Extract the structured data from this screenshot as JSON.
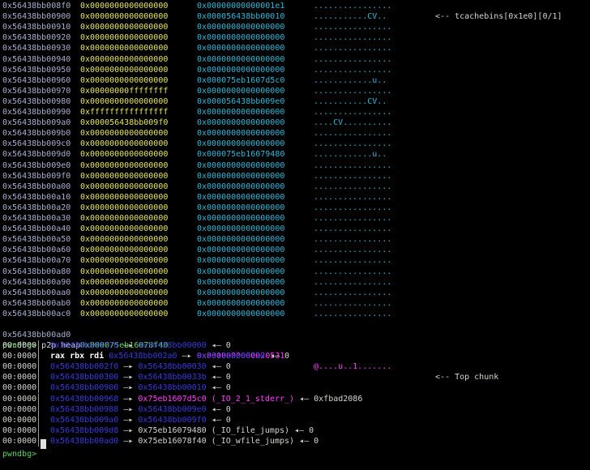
{
  "heap_rows": [
    {
      "addr": "0x56438bb008f0",
      "q1": "0x0000000000000000",
      "q2": "0x00000000000001e1",
      "ascii": "................",
      "note": ""
    },
    {
      "addr": "0x56438bb00900",
      "q1": "0x0000000000000000",
      "q2": "0x000056438bb00010",
      "ascii": "...........CV..",
      "note": "<-- tcachebins[0x1e0][0/1]"
    },
    {
      "addr": "0x56438bb00910",
      "q1": "0x0000000000000000",
      "q2": "0x0000000000000000",
      "ascii": "................",
      "note": ""
    },
    {
      "addr": "0x56438bb00920",
      "q1": "0x0000000000000000",
      "q2": "0x0000000000000000",
      "ascii": "................",
      "note": ""
    },
    {
      "addr": "0x56438bb00930",
      "q1": "0x0000000000000000",
      "q2": "0x0000000000000000",
      "ascii": "................",
      "note": ""
    },
    {
      "addr": "0x56438bb00940",
      "q1": "0x0000000000000000",
      "q2": "0x0000000000000000",
      "ascii": "................",
      "note": ""
    },
    {
      "addr": "0x56438bb00950",
      "q1": "0x0000000000000000",
      "q2": "0x0000000000000000",
      "ascii": "................",
      "note": ""
    },
    {
      "addr": "0x56438bb00960",
      "q1": "0x0000000000000000",
      "q2": "0x000075eb1607d5c0",
      "ascii": "............u..",
      "note": ""
    },
    {
      "addr": "0x56438bb00970",
      "q1": "0x00000000ffffffff",
      "q2": "0x0000000000000000",
      "ascii": "................",
      "note": ""
    },
    {
      "addr": "0x56438bb00980",
      "q1": "0x0000000000000000",
      "q2": "0x000056438bb009e0",
      "ascii": "...........CV..",
      "note": ""
    },
    {
      "addr": "0x56438bb00990",
      "q1": "0xffffffffffffffff",
      "q2": "0x0000000000000000",
      "ascii": "................",
      "note": ""
    },
    {
      "addr": "0x56438bb009a0",
      "q1": "0x000056438bb009f0",
      "q2": "0x0000000000000000",
      "ascii": "....CV..........",
      "note": ""
    },
    {
      "addr": "0x56438bb009b0",
      "q1": "0x0000000000000000",
      "q2": "0x0000000000000000",
      "ascii": "................",
      "note": ""
    },
    {
      "addr": "0x56438bb009c0",
      "q1": "0x0000000000000000",
      "q2": "0x0000000000000000",
      "ascii": "................",
      "note": ""
    },
    {
      "addr": "0x56438bb009d0",
      "q1": "0x0000000000000000",
      "q2": "0x000075eb16079480",
      "ascii": "............u..",
      "note": ""
    },
    {
      "addr": "0x56438bb009e0",
      "q1": "0x0000000000000000",
      "q2": "0x0000000000000000",
      "ascii": "................",
      "note": ""
    },
    {
      "addr": "0x56438bb009f0",
      "q1": "0x0000000000000000",
      "q2": "0x0000000000000000",
      "ascii": "................",
      "note": ""
    },
    {
      "addr": "0x56438bb00a00",
      "q1": "0x0000000000000000",
      "q2": "0x0000000000000000",
      "ascii": "................",
      "note": ""
    },
    {
      "addr": "0x56438bb00a10",
      "q1": "0x0000000000000000",
      "q2": "0x0000000000000000",
      "ascii": "................",
      "note": ""
    },
    {
      "addr": "0x56438bb00a20",
      "q1": "0x0000000000000000",
      "q2": "0x0000000000000000",
      "ascii": "................",
      "note": ""
    },
    {
      "addr": "0x56438bb00a30",
      "q1": "0x0000000000000000",
      "q2": "0x0000000000000000",
      "ascii": "................",
      "note": ""
    },
    {
      "addr": "0x56438bb00a40",
      "q1": "0x0000000000000000",
      "q2": "0x0000000000000000",
      "ascii": "................",
      "note": ""
    },
    {
      "addr": "0x56438bb00a50",
      "q1": "0x0000000000000000",
      "q2": "0x0000000000000000",
      "ascii": "................",
      "note": ""
    },
    {
      "addr": "0x56438bb00a60",
      "q1": "0x0000000000000000",
      "q2": "0x0000000000000000",
      "ascii": "................",
      "note": ""
    },
    {
      "addr": "0x56438bb00a70",
      "q1": "0x0000000000000000",
      "q2": "0x0000000000000000",
      "ascii": "................",
      "note": ""
    },
    {
      "addr": "0x56438bb00a80",
      "q1": "0x0000000000000000",
      "q2": "0x0000000000000000",
      "ascii": "................",
      "note": ""
    },
    {
      "addr": "0x56438bb00a90",
      "q1": "0x0000000000000000",
      "q2": "0x0000000000000000",
      "ascii": "................",
      "note": ""
    },
    {
      "addr": "0x56438bb00aa0",
      "q1": "0x0000000000000000",
      "q2": "0x0000000000000000",
      "ascii": "................",
      "note": ""
    },
    {
      "addr": "0x56438bb00ab0",
      "q1": "0x0000000000000000",
      "q2": "0x0000000000000000",
      "ascii": "................",
      "note": ""
    },
    {
      "addr": "0x56438bb00ac0",
      "q1": "0x0000000000000000",
      "q2": "0x0000000000000000",
      "ascii": "................",
      "note": ""
    }
  ],
  "top_row": {
    "addr": "0x56438bb00ad0",
    "q1": "0x000075eb16078f40",
    "q2": "0x0000000000020531",
    "ascii": "@....u..1.......",
    "note": "<-- Top chunk"
  },
  "prompt": {
    "name": "pwndbg>",
    "command": " p2p heap"
  },
  "telescope": [
    {
      "off": "00:0000",
      "parts": [
        [
          "b",
          "0x56438bb00170"
        ],
        [
          "w",
          " —▸ "
        ],
        [
          "b",
          "0x56438bb00000"
        ],
        [
          "w",
          " ◂— 0"
        ]
      ]
    },
    {
      "off": "00:0000",
      "parts": [
        [
          "reg",
          "rax rbx rdi"
        ],
        [
          "w",
          " "
        ],
        [
          "b",
          "0x56438bb002a0"
        ],
        [
          "w",
          " —▸ "
        ],
        [
          "b",
          "0x56438bb00720"
        ],
        [
          "w",
          " ◂— 0"
        ]
      ]
    },
    {
      "off": "00:0000",
      "parts": [
        [
          "b",
          "0x56438bb002f0"
        ],
        [
          "w",
          " —▸ "
        ],
        [
          "b",
          "0x56438bb00030"
        ],
        [
          "w",
          " ◂— 0"
        ]
      ]
    },
    {
      "off": "00:0000",
      "parts": [
        [
          "b",
          "0x56438bb00300"
        ],
        [
          "w",
          " —▸ "
        ],
        [
          "b",
          "0x56438bb0033b"
        ],
        [
          "w",
          " ◂— 0"
        ]
      ]
    },
    {
      "off": "00:0000",
      "parts": [
        [
          "b",
          "0x56438bb00900"
        ],
        [
          "w",
          " —▸ "
        ],
        [
          "b",
          "0x56438bb00010"
        ],
        [
          "w",
          " ◂— 0"
        ]
      ]
    },
    {
      "off": "00:0000",
      "parts": [
        [
          "b",
          "0x56438bb00968"
        ],
        [
          "w",
          " —▸ "
        ],
        [
          "m",
          "0x75eb1607d5c0"
        ],
        [
          "m",
          " (_IO_2_1_stderr_)"
        ],
        [
          "w",
          " ◂— 0xfbad2086"
        ]
      ]
    },
    {
      "off": "00:0000",
      "parts": [
        [
          "b",
          "0x56438bb00988"
        ],
        [
          "w",
          " —▸ "
        ],
        [
          "b",
          "0x56438bb009e0"
        ],
        [
          "w",
          " ◂— 0"
        ]
      ]
    },
    {
      "off": "00:0000",
      "parts": [
        [
          "b",
          "0x56438bb009a0"
        ],
        [
          "w",
          " —▸ "
        ],
        [
          "b",
          "0x56438bb009f0"
        ],
        [
          "w",
          " ◂— 0"
        ]
      ]
    },
    {
      "off": "00:0000",
      "parts": [
        [
          "b",
          "0x56438bb009d8"
        ],
        [
          "w",
          " —▸ 0x75eb16079480 (_IO_file_jumps) ◂— 0"
        ]
      ]
    },
    {
      "off": "00:0000",
      "parts": [
        [
          "b",
          "0x56438bb00ad0"
        ],
        [
          "w",
          " —▸ 0x75eb16078f40 (_IO_wfile_jumps) ◂— 0"
        ]
      ]
    }
  ],
  "last_prompt": "pwndbg> "
}
